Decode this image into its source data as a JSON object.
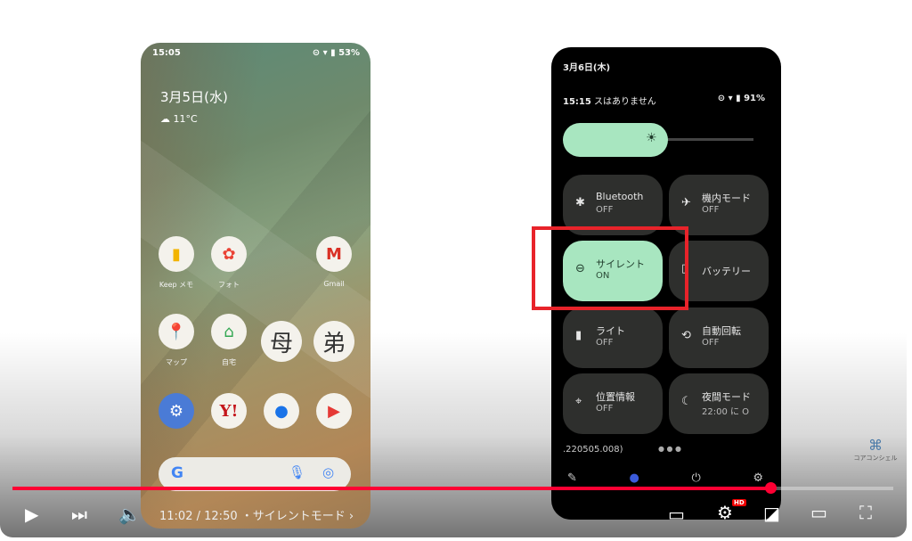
{
  "left_phone": {
    "time": "15:05",
    "battery": "53%",
    "date": "3月5日(水)",
    "weather": "11°C",
    "apps": [
      {
        "label": "Keep メモ"
      },
      {
        "label": "フォト"
      },
      {
        "label": "Gmail"
      },
      {
        "label": "マップ"
      },
      {
        "label": "自宅"
      },
      {
        "glyph": "母"
      },
      {
        "glyph": "弟"
      },
      {
        "label": ""
      },
      {
        "glyph": "Y!"
      },
      {
        "label": ""
      },
      {
        "label": ""
      }
    ],
    "search_logo": "G"
  },
  "right_phone": {
    "date": "3月6日(木)",
    "time": "15:15",
    "notice": "スはありません",
    "battery": "91%",
    "brightness": 0.55,
    "tiles": [
      {
        "title": "Bluetooth",
        "state": "OFF"
      },
      {
        "title": "機内モード",
        "state": "OFF"
      },
      {
        "title": "サイレント",
        "state": "ON"
      },
      {
        "title": "バッテリー",
        "state": ""
      },
      {
        "title": "ライト",
        "state": "OFF"
      },
      {
        "title": "自動回転",
        "state": "OFF"
      },
      {
        "title": "位置情報",
        "state": "OFF"
      },
      {
        "title": "夜間モード",
        "state": "22:00 に O"
      }
    ],
    "build": ".220505.008)"
  },
  "highlight_color": "#e8232a",
  "watermark": "コアコンシェル",
  "player": {
    "current": "11:02",
    "duration": "12:50",
    "separator": "/",
    "chapter": "・サイレントモード",
    "progress": 0.86,
    "quality_badge": "HD",
    "accent": "#ff0033"
  }
}
